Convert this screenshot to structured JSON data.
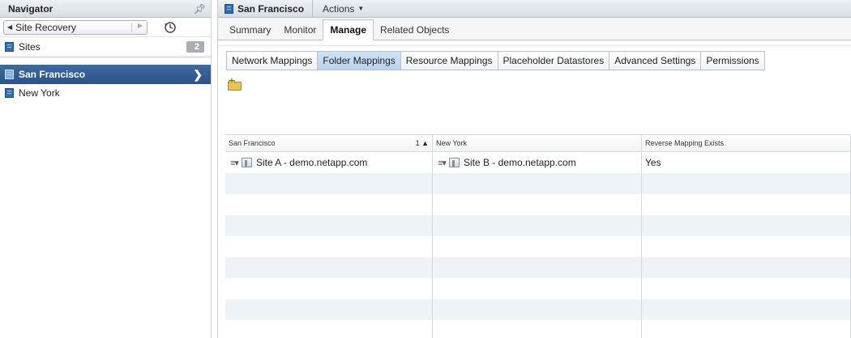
{
  "navigator": {
    "title": "Navigator",
    "back_label": "Site Recovery",
    "sites": {
      "label": "Sites",
      "count": "2"
    },
    "items": [
      {
        "label": "San Francisco",
        "selected": true
      },
      {
        "label": "New York",
        "selected": false
      }
    ]
  },
  "header": {
    "title": "San Francisco",
    "actions_label": "Actions"
  },
  "tabs": [
    {
      "label": "Summary",
      "active": false
    },
    {
      "label": "Monitor",
      "active": false
    },
    {
      "label": "Manage",
      "active": true
    },
    {
      "label": "Related Objects",
      "active": false
    }
  ],
  "subtabs": [
    {
      "label": "Network Mappings",
      "active": false
    },
    {
      "label": "Folder Mappings",
      "active": true
    },
    {
      "label": "Resource Mappings",
      "active": false
    },
    {
      "label": "Placeholder Datastores",
      "active": false
    },
    {
      "label": "Advanced Settings",
      "active": false
    },
    {
      "label": "Permissions",
      "active": false
    }
  ],
  "toolbar": {
    "icons": [
      "add-folder-mapping-icon"
    ]
  },
  "grid": {
    "columns": [
      {
        "label": "San Francisco",
        "sort": "1 ▲"
      },
      {
        "label": "New York",
        "sort": ""
      },
      {
        "label": "Reverse Mapping Exists",
        "sort": ""
      }
    ],
    "rows": [
      [
        "Site A - demo.netapp.com",
        "Site B - demo.netapp.com",
        "Yes"
      ]
    ],
    "empty_rows": 8
  },
  "colors": {
    "selection": "#2b5489",
    "active_subtab": "#b8d3ef",
    "row_stripe": "#eef3f8"
  }
}
